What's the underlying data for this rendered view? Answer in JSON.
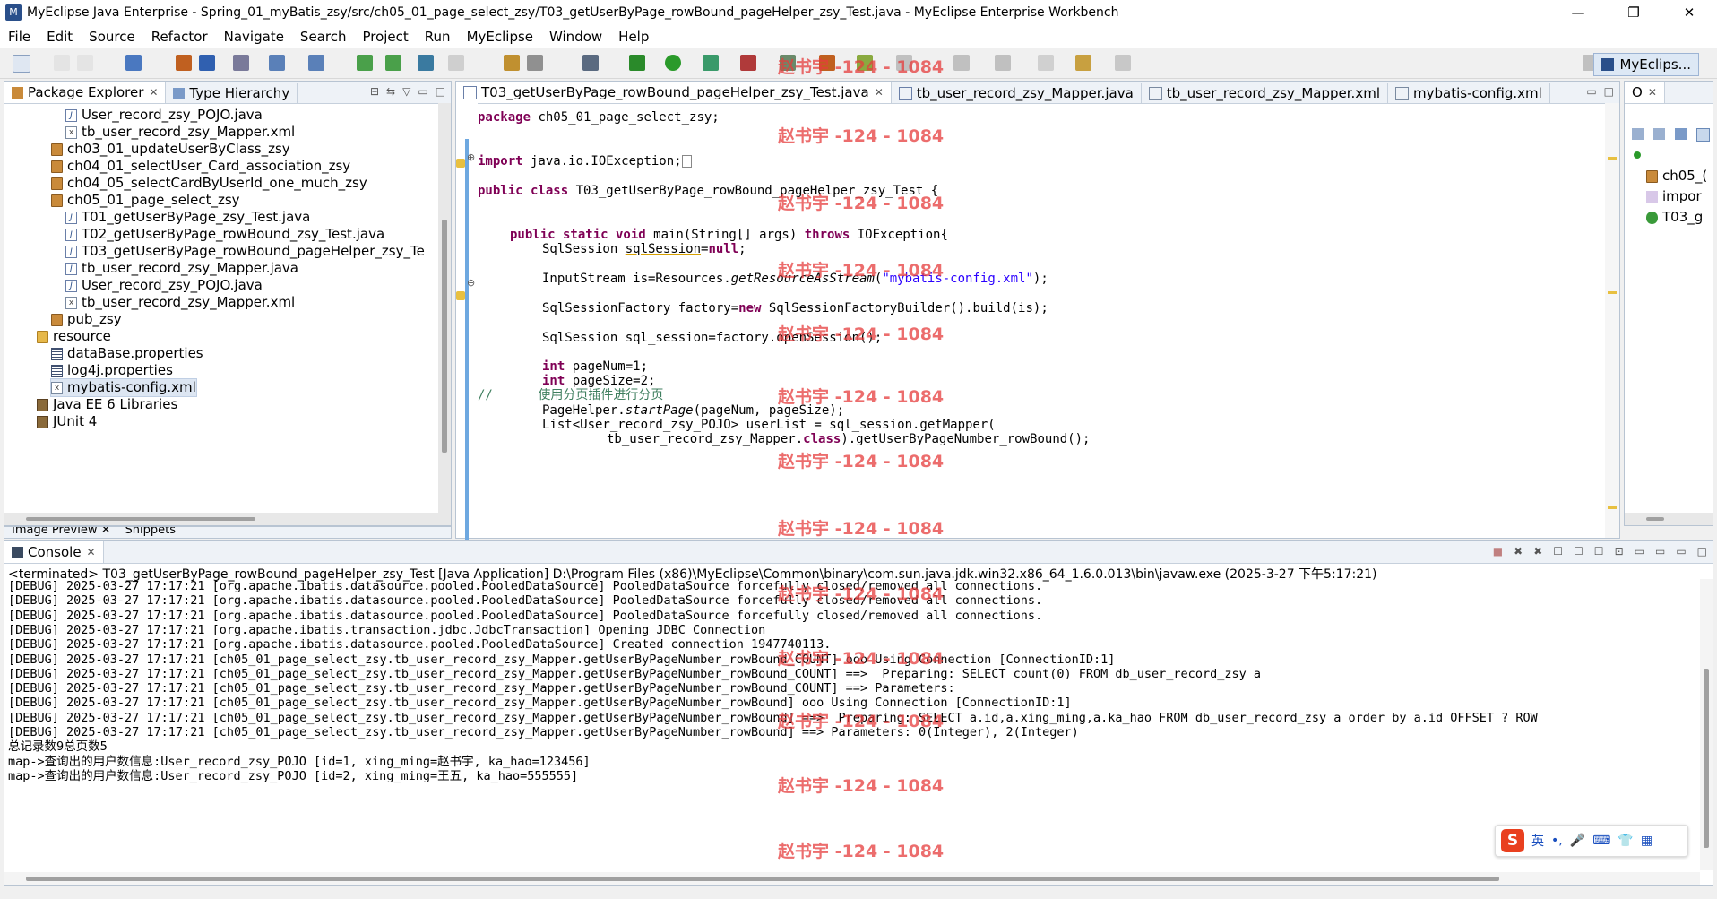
{
  "window": {
    "title": "MyEclipse Java Enterprise - Spring_01_myBatis_zsy/src/ch05_01_page_select_zsy/T03_getUserByPage_rowBound_pageHelper_zsy_Test.java - MyEclipse Enterprise Workbench",
    "minimize": "—",
    "maximize": "❐",
    "close": "✕"
  },
  "menu": [
    "File",
    "Edit",
    "Source",
    "Refactor",
    "Navigate",
    "Search",
    "Project",
    "Run",
    "MyEclipse",
    "Window",
    "Help"
  ],
  "perspective": {
    "label": "MyEclips..."
  },
  "package_explorer": {
    "tabs": [
      {
        "label": "Package Explorer",
        "close": "✕"
      },
      {
        "label": "Type Hierarchy"
      }
    ],
    "tree": [
      {
        "label": "User_record_zsy_POJO.java",
        "icon": "java-file-icon",
        "indent": 2
      },
      {
        "label": "tb_user_record_zsy_Mapper.xml",
        "icon": "xml-file-icon",
        "indent": 2
      },
      {
        "label": "ch03_01_updateUserByClass_zsy",
        "icon": "package-icon",
        "indent": 1
      },
      {
        "label": "ch04_01_selectUser_Card_association_zsy",
        "icon": "package-icon",
        "indent": 1
      },
      {
        "label": "ch04_05_selectCardByUserId_one_much_zsy",
        "icon": "package-icon",
        "indent": 1
      },
      {
        "label": "ch05_01_page_select_zsy",
        "icon": "package-icon",
        "indent": 1
      },
      {
        "label": "T01_getUserByPage_zsy_Test.java",
        "icon": "java-file-icon",
        "indent": 2
      },
      {
        "label": "T02_getUserByPage_rowBound_zsy_Test.java",
        "icon": "java-file-icon",
        "indent": 2
      },
      {
        "label": "T03_getUserByPage_rowBound_pageHelper_zsy_Te",
        "icon": "java-file-icon",
        "indent": 2
      },
      {
        "label": "tb_user_record_zsy_Mapper.java",
        "icon": "java-file-icon",
        "indent": 2
      },
      {
        "label": "User_record_zsy_POJO.java",
        "icon": "java-file-icon",
        "indent": 2
      },
      {
        "label": "tb_user_record_zsy_Mapper.xml",
        "icon": "xml-file-icon",
        "indent": 2
      },
      {
        "label": "pub_zsy",
        "icon": "package-icon",
        "indent": 1
      },
      {
        "label": "resource",
        "icon": "folder-icon",
        "indent": 0
      },
      {
        "label": "dataBase.properties",
        "icon": "properties-file-icon",
        "indent": 1
      },
      {
        "label": "log4j.properties",
        "icon": "properties-file-icon",
        "indent": 1
      },
      {
        "label": "mybatis-config.xml",
        "icon": "xml-file-icon",
        "indent": 1,
        "selected": true
      },
      {
        "label": "Java EE 6 Libraries",
        "icon": "library-icon",
        "indent": 0
      },
      {
        "label": "JUnit 4",
        "icon": "library-icon",
        "indent": 0
      }
    ]
  },
  "lower_left_tabs": [
    {
      "label": "Image Preview",
      "close": "✕"
    },
    {
      "label": "Snippets"
    }
  ],
  "editor": {
    "tabs": [
      {
        "label": "T03_getUserByPage_rowBound_pageHelper_zsy_Test.java",
        "close": "✕",
        "active": true
      },
      {
        "label": "tb_user_record_zsy_Mapper.java"
      },
      {
        "label": "tb_user_record_zsy_Mapper.xml"
      },
      {
        "label": "mybatis-config.xml"
      }
    ],
    "lines": {
      "l1_kw": "package",
      "l1_rest": " ch05_01_page_select_zsy;",
      "l2_kw": "import",
      "l2_rest": " java.io.IOException;",
      "l3_kw1": "public class",
      "l3_rest": " T03_getUserByPage_rowBound_pageHelper_zsy_Test {",
      "l4_kw1": "public static void",
      "l4_mid": " main(String[] args) ",
      "l4_kw2": "throws",
      "l4_rest": " IOException{",
      "l5_a": "SqlSession ",
      "l5_b": "sqlSession",
      "l5_c": "=",
      "l5_kw": "null",
      "l5_d": ";",
      "l6_a": "InputStream is=Resources.",
      "l6_b": "getResourceAsStream",
      "l6_c": "(",
      "l6_str": "\"mybatis-config.xml\"",
      "l6_d": ");",
      "l7_a": "SqlSessionFactory factory=",
      "l7_kw": "new",
      "l7_b": " SqlSessionFactoryBuilder().build(is);",
      "l8": "SqlSession sql_session=factory.openSession();",
      "l9_kw": "int",
      "l9_rest": " pageNum=1;",
      "l10_kw": "int",
      "l10_rest": " pageSize=2;",
      "l11_com": "//      使用分页插件进行分页",
      "l12_a": "PageHelper.",
      "l12_b": "startPage",
      "l12_c": "(pageNum, pageSize);",
      "l13": "List<User_record_zsy_POJO> userList = sql_session.getMapper(",
      "l14_a": "tb_user_record_zsy_Mapper.",
      "l14_kw": "class",
      "l14_b": ").getUserByPageNumber_rowBound();"
    }
  },
  "outline": {
    "tab": "O",
    "close": "✕",
    "items": [
      "ch05_(",
      "impor",
      "T03_g"
    ]
  },
  "console": {
    "tab": "Console",
    "close": "✕",
    "header": "<terminated> T03_getUserByPage_rowBound_pageHelper_zsy_Test [Java Application] D:\\Program Files (x86)\\MyEclipse\\Common\\binary\\com.sun.java.jdk.win32.x86_64_1.6.0.013\\bin\\javaw.exe (2025-3-27 下午5:17:21)",
    "lines": [
      "[DEBUG] 2025-03-27 17:17:21 [org.apache.ibatis.datasource.pooled.PooledDataSource] PooledDataSource forcefully closed/removed all connections.",
      "[DEBUG] 2025-03-27 17:17:21 [org.apache.ibatis.datasource.pooled.PooledDataSource] PooledDataSource forcefully closed/removed all connections.",
      "[DEBUG] 2025-03-27 17:17:21 [org.apache.ibatis.datasource.pooled.PooledDataSource] PooledDataSource forcefully closed/removed all connections.",
      "[DEBUG] 2025-03-27 17:17:21 [org.apache.ibatis.transaction.jdbc.JdbcTransaction] Opening JDBC Connection",
      "[DEBUG] 2025-03-27 17:17:21 [org.apache.ibatis.datasource.pooled.PooledDataSource] Created connection 1947740113.",
      "[DEBUG] 2025-03-27 17:17:21 [ch05_01_page_select_zsy.tb_user_record_zsy_Mapper.getUserByPageNumber_rowBound_COUNT] ooo Using Connection [ConnectionID:1]",
      "[DEBUG] 2025-03-27 17:17:21 [ch05_01_page_select_zsy.tb_user_record_zsy_Mapper.getUserByPageNumber_rowBound_COUNT] ==>  Preparing: SELECT count(0) FROM db_user_record_zsy a",
      "[DEBUG] 2025-03-27 17:17:21 [ch05_01_page_select_zsy.tb_user_record_zsy_Mapper.getUserByPageNumber_rowBound_COUNT] ==> Parameters: ",
      "[DEBUG] 2025-03-27 17:17:21 [ch05_01_page_select_zsy.tb_user_record_zsy_Mapper.getUserByPageNumber_rowBound] ooo Using Connection [ConnectionID:1]",
      "[DEBUG] 2025-03-27 17:17:21 [ch05_01_page_select_zsy.tb_user_record_zsy_Mapper.getUserByPageNumber_rowBound] ==>  Preparing: SELECT a.id,a.xing_ming,a.ka_hao FROM db_user_record_zsy a order by a.id OFFSET ? ROW",
      "[DEBUG] 2025-03-27 17:17:21 [ch05_01_page_select_zsy.tb_user_record_zsy_Mapper.getUserByPageNumber_rowBound] ==> Parameters: 0(Integer), 2(Integer)",
      "总记录数9总页数5",
      "map->查询出的用户数信息:User_record_zsy_POJO [id=1, xing_ming=赵书宇, ka_hao=123456]",
      "map->查询出的用户数信息:User_record_zsy_POJO [id=2, xing_ming=王五, ka_hao=555555]"
    ]
  },
  "watermark": "赵书宇 -124 - 1084",
  "ime": {
    "logo": "S",
    "mode": "英",
    "extra": "•,"
  }
}
